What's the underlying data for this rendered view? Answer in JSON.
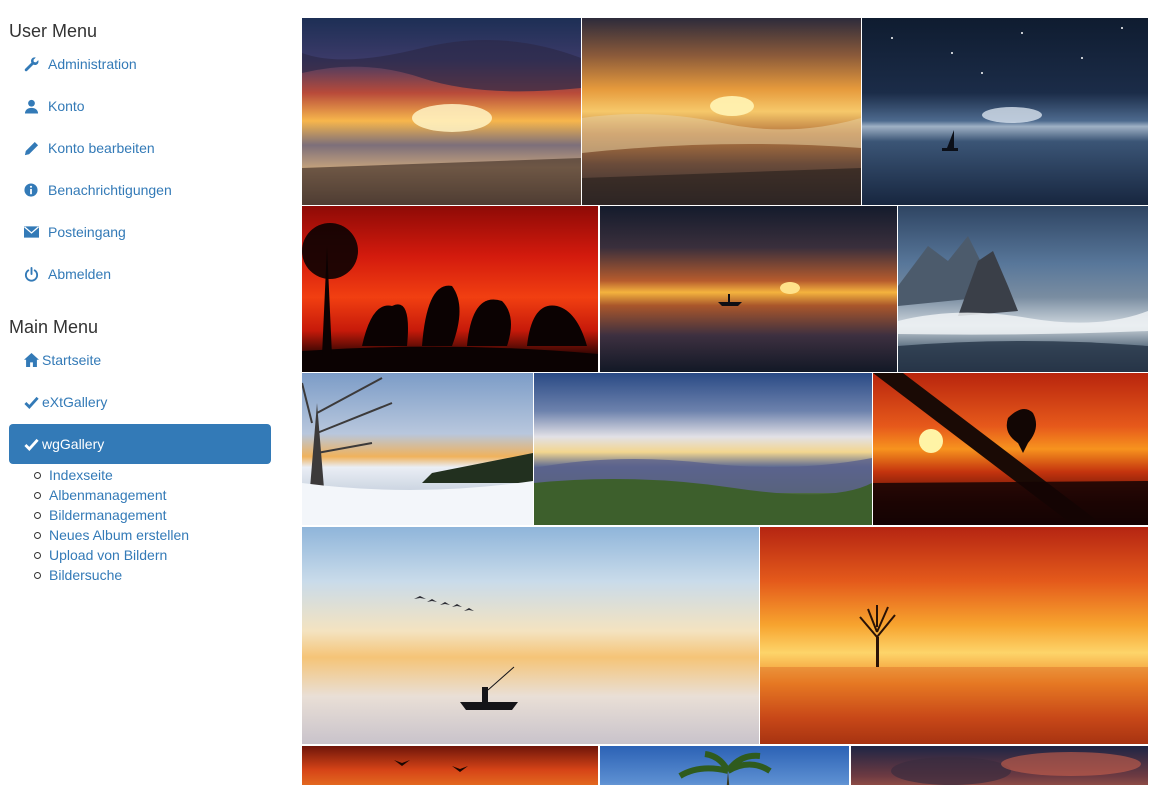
{
  "user_menu": {
    "title": "User Menu",
    "items": [
      {
        "label": "Administration",
        "icon": "wrench-icon"
      },
      {
        "label": "Konto",
        "icon": "user-icon"
      },
      {
        "label": "Konto bearbeiten",
        "icon": "pencil-icon"
      },
      {
        "label": "Benachrichtigungen",
        "icon": "info-icon"
      },
      {
        "label": "Posteingang",
        "icon": "envelope-icon"
      },
      {
        "label": "Abmelden",
        "icon": "power-icon"
      }
    ]
  },
  "main_menu": {
    "title": "Main Menu",
    "items": [
      {
        "label": "Startseite",
        "icon": "home-icon"
      },
      {
        "label": "eXtGallery",
        "icon": "checkmark-icon"
      },
      {
        "label": "wgGallery",
        "icon": "checkmark-icon",
        "active": true
      }
    ],
    "submenu": [
      {
        "label": "Indexseite"
      },
      {
        "label": "Albenmanagement"
      },
      {
        "label": "Bildermanagement"
      },
      {
        "label": "Neues Album erstellen"
      },
      {
        "label": "Upload von Bildern"
      },
      {
        "label": "Bildersuche"
      }
    ]
  },
  "gallery": {
    "images": [
      {
        "name": "sunset-clouds-beach"
      },
      {
        "name": "golden-sea-sunset"
      },
      {
        "name": "night-sailboat"
      },
      {
        "name": "red-sky-horses"
      },
      {
        "name": "sunset-boat-calm-sea"
      },
      {
        "name": "rocky-coast-waves"
      },
      {
        "name": "winter-lake-tree"
      },
      {
        "name": "mountain-valley-sunbeams"
      },
      {
        "name": "bird-on-branch-sunset"
      },
      {
        "name": "fisherman-boat-birds"
      },
      {
        "name": "lone-tree-orange-lake"
      },
      {
        "name": "sunset-birds-partial"
      },
      {
        "name": "palm-tree-partial"
      },
      {
        "name": "cloudy-sky-partial"
      }
    ]
  },
  "colors": {
    "link": "#337ab7",
    "active_bg": "#337ab7",
    "active_text": "#ffffff",
    "heading": "#333333"
  }
}
